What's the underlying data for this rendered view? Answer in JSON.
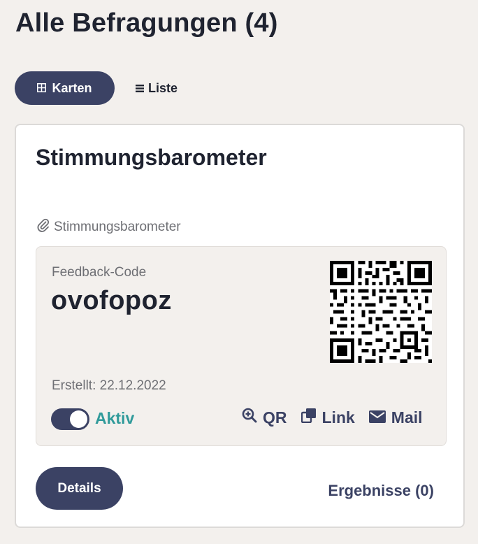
{
  "page": {
    "title": "Alle Befragungen (4)"
  },
  "view_toggle": {
    "cards_label": "Karten",
    "cards_icon": "grid-icon",
    "list_label": "Liste",
    "list_icon": "list-icon",
    "active": "cards"
  },
  "card": {
    "title": "Stimmungsbarometer",
    "attachment_label": "Stimmungsbarometer",
    "attachment_icon": "paperclip-icon",
    "code_label": "Feedback-Code",
    "code_value": "ovofopoz",
    "created": "Erstellt: 22.12.2022",
    "status": "Aktiv",
    "status_active": true,
    "actions": {
      "qr": "QR",
      "link": "Link",
      "mail": "Mail"
    },
    "details_label": "Details",
    "results_label": "Ergebnisse (0)"
  },
  "colors": {
    "primary": "#3b4264",
    "status": "#2f9a9a",
    "background": "#f3f0ed"
  }
}
